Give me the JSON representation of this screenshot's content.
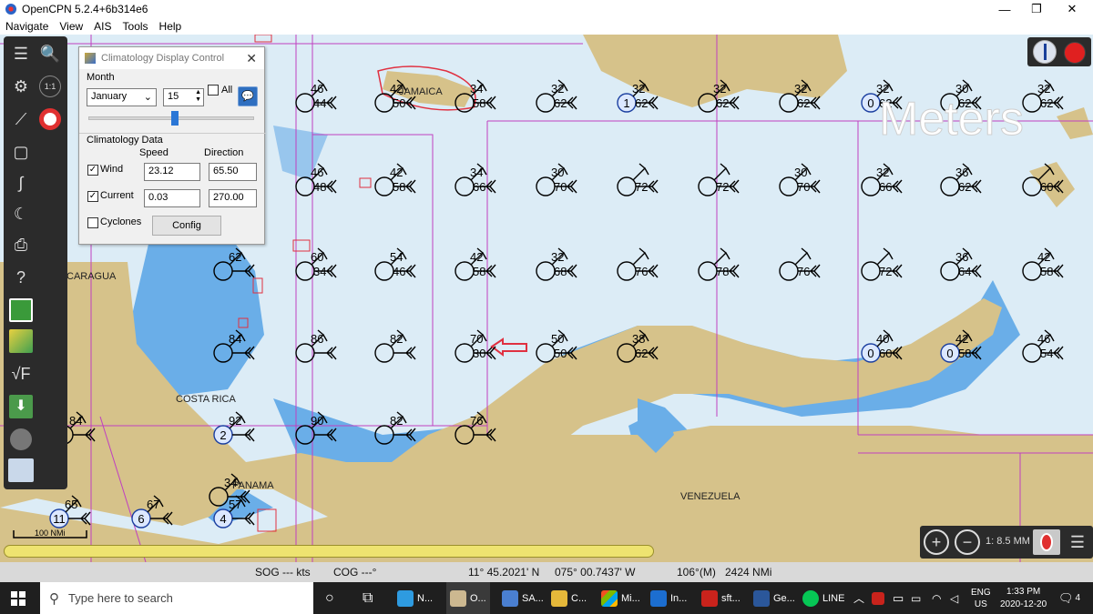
{
  "window": {
    "title": "OpenCPN 5.2.4+6b314e6",
    "minimize": "—",
    "maximize": "❐",
    "close": "✕"
  },
  "menu": [
    "Navigate",
    "View",
    "AIS",
    "Tools",
    "Help"
  ],
  "dialog": {
    "title": "Climatology Display Control",
    "month_label": "Month",
    "month_value": "January",
    "day_value": "15",
    "all_label": "All",
    "slider_percent": 52,
    "data_label": "Climatology Data",
    "speed_header": "Speed",
    "direction_header": "Direction",
    "wind_label": "Wind",
    "wind_checked": true,
    "wind_speed": "23.12",
    "wind_direction": "65.50",
    "current_label": "Current",
    "current_checked": true,
    "current_speed": "0.03",
    "current_direction": "270.00",
    "cyclones_label": "Cyclones",
    "cyclones_checked": false,
    "config_label": "Config"
  },
  "chart": {
    "watermark": "Meters",
    "places": [
      "JAMAICA",
      "NICARAGUA",
      "COSTA RICA",
      "PANAMA",
      "VENEZUELA"
    ],
    "scale_label": "100 NMi",
    "scale_value": "1: 8.5 MM",
    "colors": {
      "water": "#dcecf6",
      "shallow": "#6aaee8",
      "land": "#d6c28a",
      "grid": "#c040c0"
    },
    "stations": [
      {
        "top": "46",
        "bottom": "44",
        "badge": ""
      },
      {
        "top": "42",
        "bottom": "50",
        "badge": ""
      },
      {
        "top": "34",
        "bottom": "58",
        "badge": ""
      },
      {
        "top": "32",
        "bottom": "62",
        "badge": ""
      },
      {
        "top": "32",
        "bottom": "62",
        "badge": "1"
      },
      {
        "top": "32",
        "bottom": "62",
        "badge": ""
      },
      {
        "top": "32",
        "bottom": "62",
        "badge": ""
      },
      {
        "top": "32",
        "bottom": "62",
        "badge": "0"
      },
      {
        "top": "30",
        "bottom": "62",
        "badge": ""
      },
      {
        "top": "32",
        "bottom": "62",
        "badge": ""
      },
      {
        "top": "46",
        "bottom": "48",
        "badge": ""
      },
      {
        "top": "42",
        "bottom": "58",
        "badge": ""
      },
      {
        "top": "34",
        "bottom": "66",
        "badge": ""
      },
      {
        "top": "30",
        "bottom": "70",
        "badge": ""
      },
      {
        "top": "",
        "bottom": "72",
        "badge": ""
      },
      {
        "top": "",
        "bottom": "72",
        "badge": ""
      },
      {
        "top": "30",
        "bottom": "70",
        "badge": ""
      },
      {
        "top": "32",
        "bottom": "66",
        "badge": ""
      },
      {
        "top": "36",
        "bottom": "62",
        "badge": ""
      },
      {
        "top": "",
        "bottom": "60",
        "badge": ""
      },
      {
        "top": "62",
        "bottom": "",
        "badge": ""
      },
      {
        "top": "60",
        "bottom": "34",
        "badge": ""
      },
      {
        "top": "54",
        "bottom": "46",
        "badge": ""
      },
      {
        "top": "42",
        "bottom": "58",
        "badge": ""
      },
      {
        "top": "32",
        "bottom": "68",
        "badge": ""
      },
      {
        "top": "",
        "bottom": "76",
        "badge": ""
      },
      {
        "top": "",
        "bottom": "78",
        "badge": ""
      },
      {
        "top": "",
        "bottom": "76",
        "badge": ""
      },
      {
        "top": "",
        "bottom": "72",
        "badge": ""
      },
      {
        "top": "36",
        "bottom": "64",
        "badge": ""
      },
      {
        "top": "42",
        "bottom": "58",
        "badge": ""
      },
      {
        "top": "84",
        "bottom": "",
        "badge": ""
      },
      {
        "top": "86",
        "bottom": "",
        "badge": ""
      },
      {
        "top": "82",
        "bottom": "",
        "badge": ""
      },
      {
        "top": "70",
        "bottom": "30",
        "badge": ""
      },
      {
        "top": "50",
        "bottom": "50",
        "badge": ""
      },
      {
        "top": "38",
        "bottom": "62",
        "badge": ""
      },
      {
        "top": "40",
        "bottom": "60",
        "badge": "0"
      },
      {
        "top": "42",
        "bottom": "58",
        "badge": "0"
      },
      {
        "top": "46",
        "bottom": "54",
        "badge": ""
      },
      {
        "top": "84",
        "bottom": "",
        "badge": ""
      },
      {
        "top": "92",
        "bottom": "",
        "badge": "2"
      },
      {
        "top": "90",
        "bottom": "",
        "badge": ""
      },
      {
        "top": "82",
        "bottom": "",
        "badge": ""
      },
      {
        "top": "76",
        "bottom": "",
        "badge": ""
      },
      {
        "top": "65",
        "bottom": "",
        "badge": "11"
      },
      {
        "top": "67",
        "bottom": "",
        "badge": "6"
      },
      {
        "top": "57",
        "bottom": "",
        "badge": "4"
      },
      {
        "top": "34",
        "bottom": "",
        "badge": ""
      }
    ]
  },
  "status": {
    "sog": "SOG --- kts",
    "cog": "COG ---°",
    "lat": "11° 45.2021' N",
    "lon": "075° 00.7437' W",
    "bearing": "106°(M)",
    "distance": "2424 NMi"
  },
  "taskbar": {
    "search_placeholder": "Type here to search",
    "apps": [
      "N...",
      "O...",
      "SA...",
      "C...",
      "Mi...",
      "In...",
      "sft...",
      "Ge...",
      "LINE"
    ],
    "lang": "ENG",
    "region": "US",
    "time": "1:33 PM",
    "date": "2020-12-20",
    "notifications": "4"
  }
}
